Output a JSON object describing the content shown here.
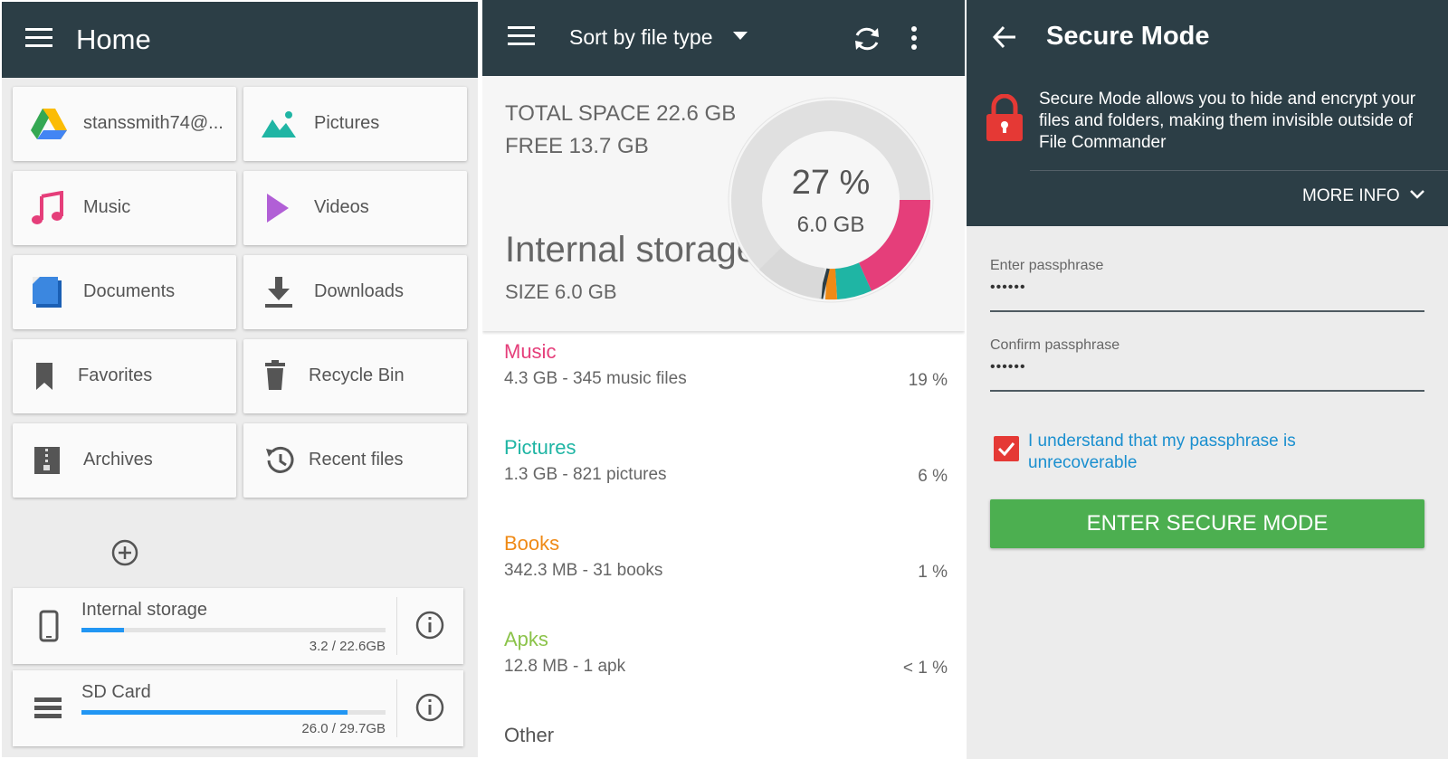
{
  "home": {
    "title": "Home",
    "tiles": [
      {
        "label": "stanssmith74@...",
        "icon": "google-drive-icon"
      },
      {
        "label": "Pictures",
        "icon": "pictures-icon"
      },
      {
        "label": "Music",
        "icon": "music-icon"
      },
      {
        "label": "Videos",
        "icon": "videos-icon"
      },
      {
        "label": "Documents",
        "icon": "documents-icon"
      },
      {
        "label": "Downloads",
        "icon": "downloads-icon"
      },
      {
        "label": "Favorites",
        "icon": "bookmark-icon"
      },
      {
        "label": "Recycle Bin",
        "icon": "trash-icon"
      },
      {
        "label": "Archives",
        "icon": "archive-icon"
      },
      {
        "label": "Recent files",
        "icon": "history-icon"
      }
    ],
    "storage": [
      {
        "name": "Internal storage",
        "size": "3.2 / 22.6GB",
        "fraction": 0.14
      },
      {
        "name": "SD Card",
        "size": "26.0 / 29.7GB",
        "fraction": 0.875
      }
    ]
  },
  "analyzer": {
    "sort_label": "Sort by file type",
    "total_space": "TOTAL SPACE 22.6 GB",
    "free": "FREE 13.7 GB",
    "storage_name": "Internal storage",
    "storage_size": "SIZE 6.0 GB",
    "donut_percent": "27 %",
    "donut_size": "6.0 GB",
    "categories": [
      {
        "name": "Music",
        "detail": "4.3 GB - 345 music files",
        "percent": "19 %",
        "color": "#e53e7a"
      },
      {
        "name": "Pictures",
        "detail": "1.3 GB - 821 pictures",
        "percent": "6 %",
        "color": "#1fb5a4"
      },
      {
        "name": "Books",
        "detail": "342.3 MB - 31 books",
        "percent": "1 %",
        "color": "#ef8a16"
      },
      {
        "name": "Apks",
        "detail": "12.8 MB - 1 apk",
        "percent": "< 1 %",
        "color": "#8bc34a"
      },
      {
        "name": "Other",
        "detail": "",
        "percent": "",
        "color": "#555555"
      }
    ]
  },
  "secure": {
    "title": "Secure Mode",
    "description": "Secure Mode allows you to hide and encrypt your files and folders, making them invisible outside of File Commander",
    "more_info": "MORE INFO",
    "pass_label": "Enter passphrase",
    "pass_value": "••••••",
    "confirm_label": "Confirm passphrase",
    "confirm_value": "••••••",
    "checkbox_label": "I understand that my passphrase is unrecoverable",
    "checkbox_checked": true,
    "button": "ENTER SECURE MODE",
    "button_color": "#4caf50"
  }
}
